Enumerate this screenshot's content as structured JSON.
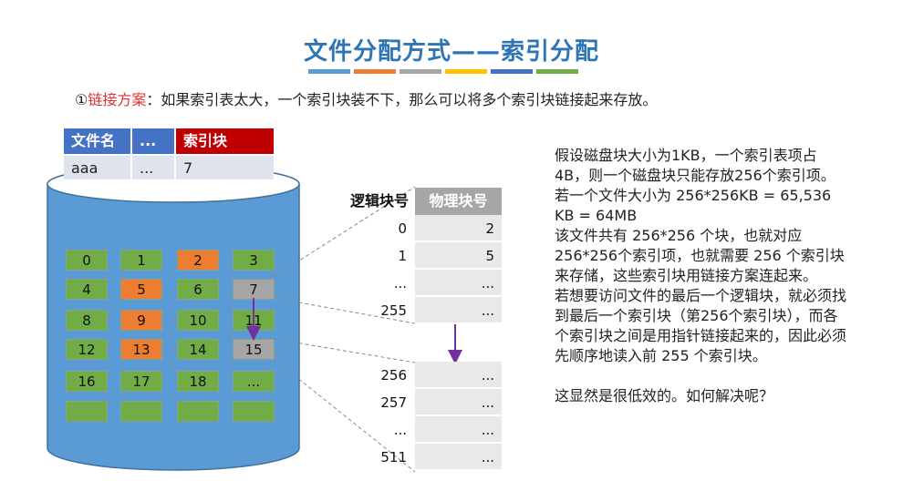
{
  "title": "文件分配方式——索引分配",
  "intro": {
    "number": "①",
    "highlight": "链接方案",
    "rest": "：如果索引表太大，一个索引块装不下，那么可以将多个索引块链接起来存放。"
  },
  "colors": {
    "title": "#2e75b6",
    "header_blue": "#4472c4",
    "header_red": "#c00000",
    "green_block": "#70ad47",
    "orange_block": "#ed7d31",
    "gray_block": "#a6a6a6",
    "disk": "#5b9bd5",
    "arrow": "#7030a0"
  },
  "file_table": {
    "headers": [
      "文件名",
      "...",
      "索引块"
    ],
    "row": [
      "aaa",
      "...",
      "7"
    ]
  },
  "disk_blocks": [
    [
      "0",
      "1",
      "2",
      "3"
    ],
    [
      "4",
      "5",
      "6",
      "7"
    ],
    [
      "8",
      "9",
      "10",
      "11"
    ],
    [
      "12",
      "13",
      "14",
      "15"
    ],
    [
      "16",
      "17",
      "18",
      "..."
    ],
    [
      "",
      "",
      "",
      ""
    ]
  ],
  "index_table": {
    "col_logical": "逻辑块号",
    "col_physical": "物理块号",
    "block1": [
      [
        "0",
        "2"
      ],
      [
        "1",
        "5"
      ],
      [
        "...",
        "..."
      ],
      [
        "255",
        "..."
      ]
    ],
    "block2": [
      [
        "256",
        "..."
      ],
      [
        "257",
        "..."
      ],
      [
        "...",
        "..."
      ],
      [
        "511",
        "..."
      ]
    ]
  },
  "explanation": [
    "假设磁盘块大小为1KB，一个索引表项占4B，则一个磁盘块只能存放256个索引项。",
    "若一个文件大小为 256*256KB = 65,536 KB = 64MB",
    "该文件共有 256*256 个块，也就对应256*256个索引项，也就需要 256 个索引块来存储，这些索引块用链接方案连起来。",
    "若想要访问文件的最后一个逻辑块，就必须找到最后一个索引块（第256个索引块），而各个索引块之间是用指针链接起来的，因此必须先顺序地读入前 255 个索引块。",
    "这显然是很低效的。如何解决呢？"
  ]
}
